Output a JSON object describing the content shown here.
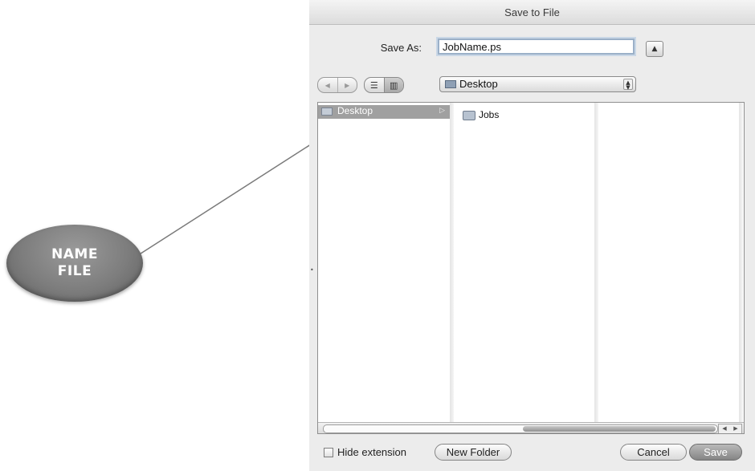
{
  "callout": {
    "text": "NAME\nFILE"
  },
  "dialog": {
    "title": "Save to File",
    "save_as_label": "Save As:",
    "filename": "JobName.ps",
    "location": "Desktop",
    "columns": {
      "col1_selected": "Desktop",
      "col2_items": [
        "Jobs"
      ]
    },
    "hide_extension_label": "Hide extension",
    "hide_extension_checked": false,
    "new_folder_label": "New Folder",
    "cancel_label": "Cancel",
    "save_label": "Save"
  },
  "icons": {
    "expand": "disclosure-triangle-icon",
    "back": "back-arrow-icon",
    "forward": "forward-arrow-icon",
    "list_view": "list-view-icon",
    "column_view": "column-view-icon",
    "desktop": "desktop-icon",
    "folder": "folder-icon"
  }
}
